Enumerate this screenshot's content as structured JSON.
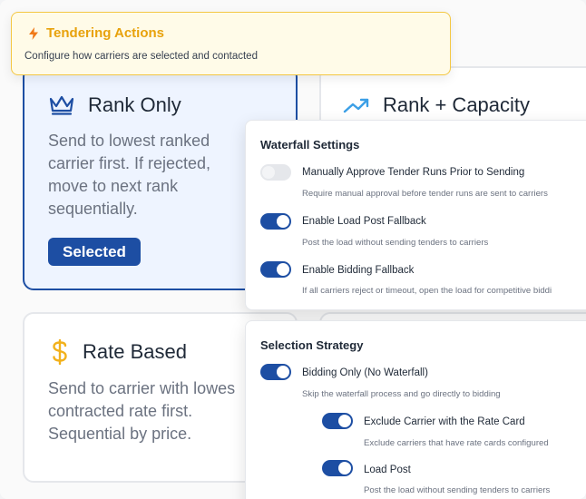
{
  "header": {
    "title": "Tendering Actions",
    "subtitle": "Configure how carriers are selected and contacted",
    "icon": "lightning-icon",
    "accent": "#e8a20c"
  },
  "cards": {
    "rank_only": {
      "title": "Rank Only",
      "icon": "crown-icon",
      "description": [
        "Send to lowest ranked",
        "carrier first. If rejected,",
        "move to next rank",
        "sequentially."
      ],
      "button_label": "Selected"
    },
    "rank_capacity": {
      "title": "Rank + Capacity",
      "icon": "trending-up-icon"
    },
    "rate_based": {
      "title": "Rate Based",
      "icon": "dollar-icon",
      "description": [
        "Send to carrier with lowes",
        "contracted rate first.",
        "Sequential by price."
      ]
    }
  },
  "waterfall": {
    "title": "Waterfall Settings",
    "options": [
      {
        "label": "Manually Approve Tender Runs Prior to Sending",
        "description": "Require manual approval before tender runs are sent to carriers",
        "enabled": false
      },
      {
        "label": "Enable Load Post Fallback",
        "description": "Post the load without sending tenders to carriers",
        "enabled": true
      },
      {
        "label": "Enable Bidding Fallback",
        "description": "If all carriers reject or timeout, open the load for competitive biddi",
        "enabled": true
      }
    ]
  },
  "selection": {
    "title": "Selection Strategy",
    "options": [
      {
        "label": "Bidding Only (No Waterfall)",
        "description": "Skip the waterfall process and go directly to bidding",
        "enabled": true
      },
      {
        "label": "Exclude Carrier with the Rate Card",
        "description": "Exclude carriers that have rate cards configured",
        "enabled": true
      },
      {
        "label": "Load Post",
        "description": "Post the load without sending tenders to carriers",
        "enabled": true
      }
    ]
  },
  "colors": {
    "primary": "#1d4ea3",
    "header_bg": "#fffbe8",
    "header_border": "#f4c742",
    "dollar": "#f2b11c",
    "trend": "#3b9fe6"
  }
}
